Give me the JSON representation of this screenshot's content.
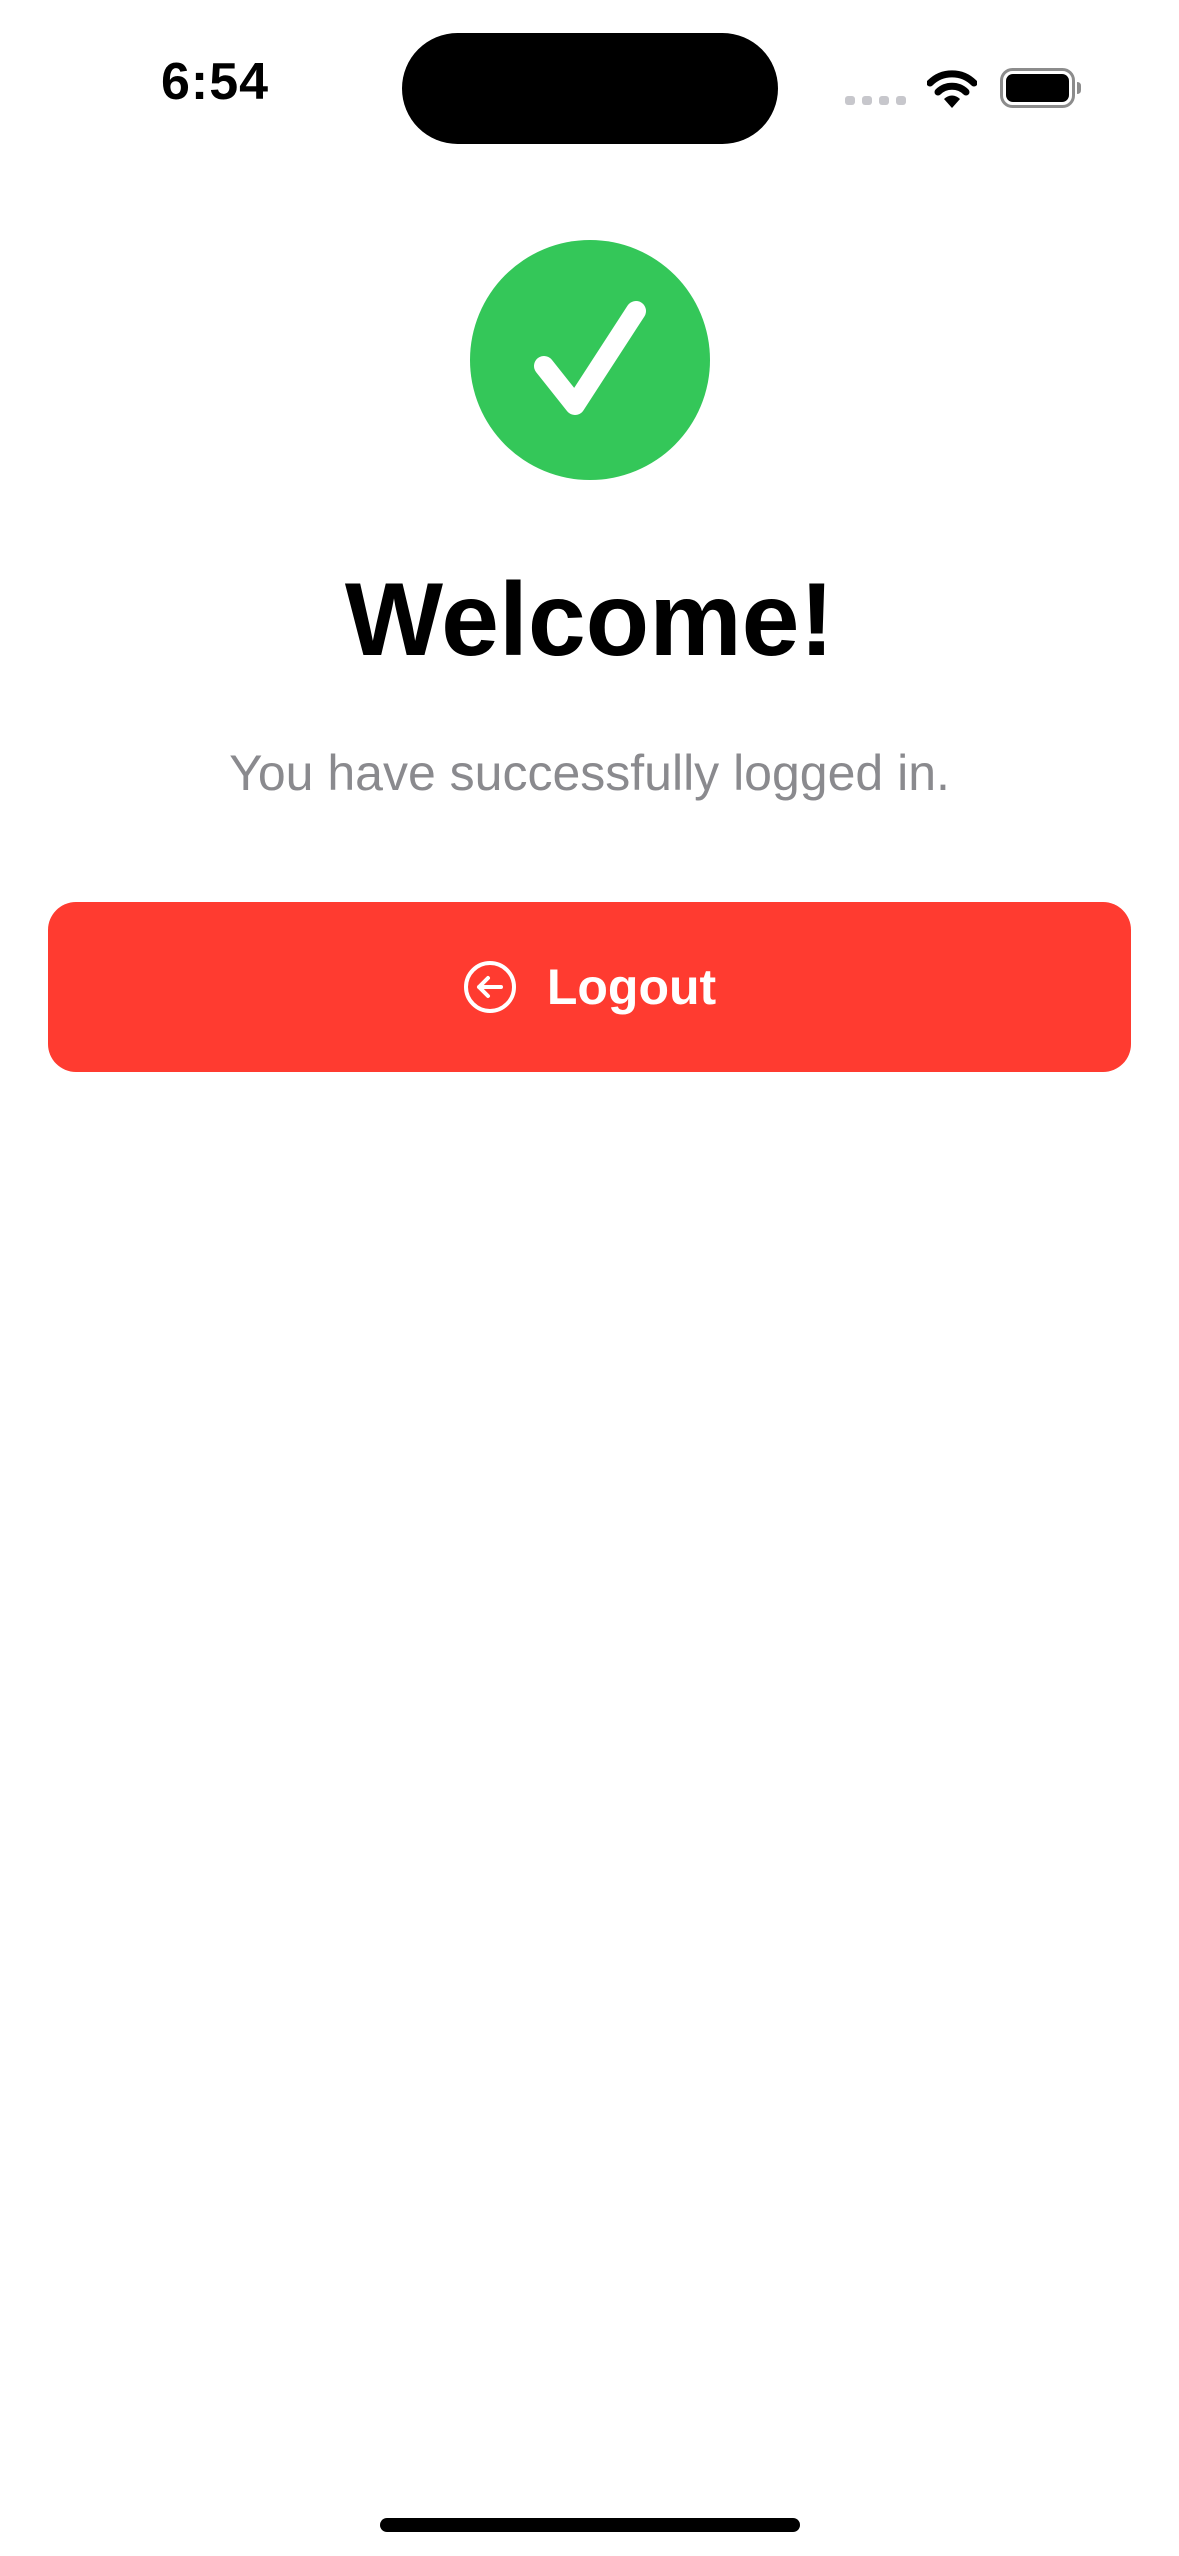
{
  "status_bar": {
    "time": "6:54",
    "icons": [
      "cellular-signal-icon",
      "wifi-icon",
      "battery-icon"
    ]
  },
  "main": {
    "badge_icon": "checkmark-icon",
    "title": "Welcome!",
    "subtitle": "You have successfully logged in.",
    "logout_button": {
      "label": "Logout",
      "icon": "arrow-left-circle-icon"
    }
  },
  "colors": {
    "success": "#34C759",
    "destructive": "#FF3B30",
    "subtitle_text": "#8A8A8E",
    "background": "#FFFFFF"
  }
}
